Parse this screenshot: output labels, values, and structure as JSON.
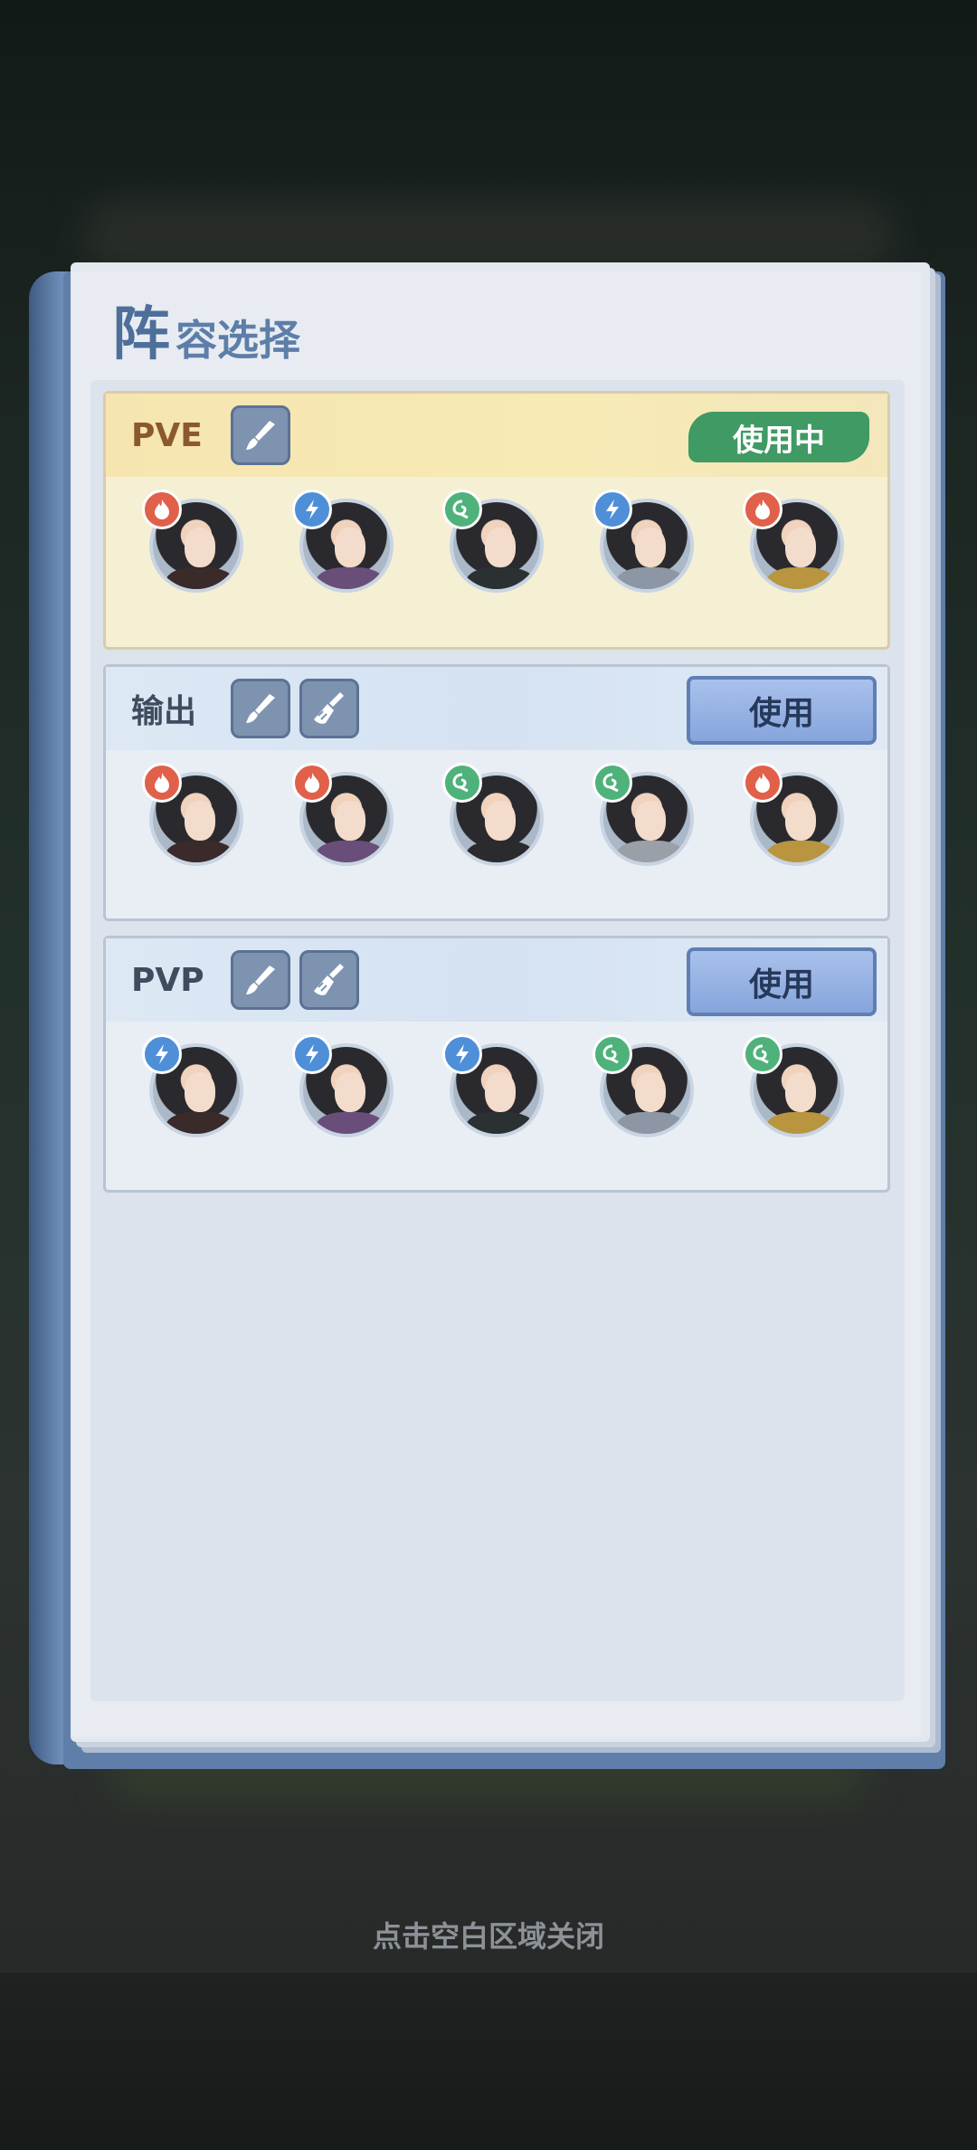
{
  "panel": {
    "title_first": "阵",
    "title_rest": "容选择"
  },
  "lineups": [
    {
      "name": "PVE",
      "status": "使用中",
      "active": true,
      "tools": [
        "brush-icon"
      ],
      "heroes": [
        {
          "element": "fire"
        },
        {
          "element": "thunder"
        },
        {
          "element": "wind"
        },
        {
          "element": "thunder"
        },
        {
          "element": "fire"
        }
      ]
    },
    {
      "name": "输出",
      "button": "使用",
      "active": false,
      "tools": [
        "brush-icon",
        "broom-icon"
      ],
      "heroes": [
        {
          "element": "fire"
        },
        {
          "element": "fire"
        },
        {
          "element": "wind"
        },
        {
          "element": "wind"
        },
        {
          "element": "fire"
        }
      ]
    },
    {
      "name": "PVP",
      "button": "使用",
      "active": false,
      "tools": [
        "brush-icon",
        "broom-icon"
      ],
      "heroes": [
        {
          "element": "thunder"
        },
        {
          "element": "thunder"
        },
        {
          "element": "thunder"
        },
        {
          "element": "wind"
        },
        {
          "element": "wind"
        }
      ]
    }
  ],
  "hint": "点击空白区域关闭",
  "colors": {
    "fire": "#e0604a",
    "thunder": "#4e8fd8",
    "wind": "#4fb27a",
    "active_pill": "#3f9a63"
  }
}
